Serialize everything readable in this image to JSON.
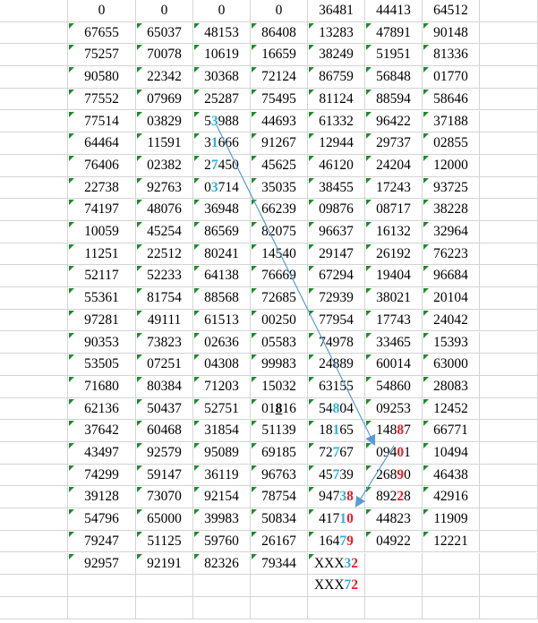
{
  "colors": {
    "grid": "#d4d4d4",
    "marker": "#1e8c2c",
    "blue": "#2bb0e0",
    "red": "#ee1c24",
    "arrow": "#5b9bd5"
  },
  "rows": [
    [
      "0",
      "0",
      "0",
      "0",
      "36481",
      "44413",
      "64512"
    ],
    [
      "67655",
      "65037",
      "48153",
      "86408",
      "13283",
      "47891",
      "90148"
    ],
    [
      "75257",
      "70078",
      "10619",
      "16659",
      "38249",
      "51951",
      "81336"
    ],
    [
      "90580",
      "22342",
      "30368",
      "72124",
      "86759",
      "56848",
      "01770"
    ],
    [
      "77552",
      "07969",
      "25287",
      "75495",
      "81124",
      "88594",
      "58646"
    ],
    [
      "77514",
      "03829",
      [
        [
          "5",
          ""
        ],
        [
          "3",
          "blue"
        ],
        [
          "988",
          ""
        ]
      ],
      "44693",
      "61332",
      "96422",
      "37188"
    ],
    [
      "64464",
      "11591",
      [
        [
          "3",
          ""
        ],
        [
          "1",
          "blue"
        ],
        [
          "666",
          ""
        ]
      ],
      "91267",
      "12944",
      "29737",
      "02855"
    ],
    [
      "76406",
      "02382",
      [
        [
          "2",
          ""
        ],
        [
          "7",
          "blue"
        ],
        [
          "450",
          ""
        ]
      ],
      "45625",
      "46120",
      "24204",
      "12000"
    ],
    [
      "22738",
      "92763",
      [
        [
          "0",
          ""
        ],
        [
          "3",
          "blue"
        ],
        [
          "714",
          ""
        ]
      ],
      "35035",
      "38455",
      "17243",
      "93725"
    ],
    [
      "74197",
      "48076",
      "36948",
      "66239",
      "09876",
      "08717",
      "38228"
    ],
    [
      "10059",
      "45254",
      "86569",
      "82075",
      "96637",
      "16132",
      "32964"
    ],
    [
      "11251",
      "22512",
      "80241",
      "14540",
      "29147",
      "26192",
      "76223"
    ],
    [
      "52117",
      "52233",
      "64138",
      "76669",
      "67294",
      "19404",
      "96684"
    ],
    [
      "55361",
      "81754",
      "88568",
      "72685",
      "72939",
      "38021",
      "20104"
    ],
    [
      "97281",
      "49111",
      "61513",
      "00250",
      "77954",
      "17743",
      "24042"
    ],
    [
      "90353",
      "73823",
      "02636",
      "05583",
      "74978",
      "33465",
      "15393"
    ],
    [
      "53505",
      "07251",
      "04308",
      "99983",
      "24889",
      "60014",
      "63000"
    ],
    [
      "71680",
      "80384",
      "71203",
      "15032",
      "63155",
      "54860",
      "28083"
    ],
    [
      "62136",
      "50437",
      "52751",
      [
        [
          "01",
          ""
        ],
        [
          "8",
          "ul"
        ],
        [
          "16",
          ""
        ]
      ],
      [
        [
          "54",
          ""
        ],
        [
          "8",
          "blue"
        ],
        [
          "04",
          ""
        ]
      ],
      "09253",
      "12452"
    ],
    [
      "37642",
      "60468",
      "31854",
      "51139",
      [
        [
          "18",
          ""
        ],
        [
          "1",
          "blue"
        ],
        [
          "65",
          ""
        ]
      ],
      [
        [
          "148",
          ""
        ],
        [
          "8",
          "red"
        ],
        [
          "7",
          ""
        ]
      ],
      "66771"
    ],
    [
      "43497",
      "92579",
      "95089",
      "69185",
      [
        [
          "72",
          ""
        ],
        [
          "7",
          "blue"
        ],
        [
          "67",
          ""
        ]
      ],
      [
        [
          "094",
          ""
        ],
        [
          "0",
          "red"
        ],
        [
          "1",
          ""
        ]
      ],
      "10494"
    ],
    [
      "74299",
      "59147",
      "36119",
      "96763",
      [
        [
          "45",
          ""
        ],
        [
          "7",
          "blue"
        ],
        [
          "39",
          ""
        ]
      ],
      [
        [
          "268",
          ""
        ],
        [
          "9",
          "red"
        ],
        [
          "0",
          ""
        ]
      ],
      "46438"
    ],
    [
      "39128",
      "73070",
      "92154",
      "78754",
      [
        [
          "947",
          ""
        ],
        [
          "3",
          "blue"
        ],
        [
          "8",
          "red"
        ]
      ],
      [
        [
          "892",
          ""
        ],
        [
          "2",
          "red"
        ],
        [
          "8",
          ""
        ]
      ],
      "42916"
    ],
    [
      "54796",
      "65000",
      "39983",
      "50834",
      [
        [
          "417",
          ""
        ],
        [
          "1",
          "blue"
        ],
        [
          "0",
          "red"
        ]
      ],
      "44823",
      "11909"
    ],
    [
      "79247",
      "51125",
      "59760",
      "26167",
      [
        [
          "164",
          ""
        ],
        [
          "7",
          "blue"
        ],
        [
          "9",
          "red"
        ]
      ],
      "04922",
      "12221"
    ],
    [
      "92957",
      "92191",
      "82326",
      "79344",
      [
        [
          "XXX",
          ""
        ],
        [
          "3",
          "blue"
        ],
        [
          "2",
          "red"
        ]
      ],
      "",
      ""
    ],
    [
      "",
      "",
      "",
      "",
      [
        [
          "XXX",
          ""
        ],
        [
          "7",
          "blue"
        ],
        [
          "2",
          "red"
        ]
      ],
      "",
      ""
    ],
    [
      "",
      "",
      "",
      "",
      "",
      "",
      ""
    ]
  ]
}
